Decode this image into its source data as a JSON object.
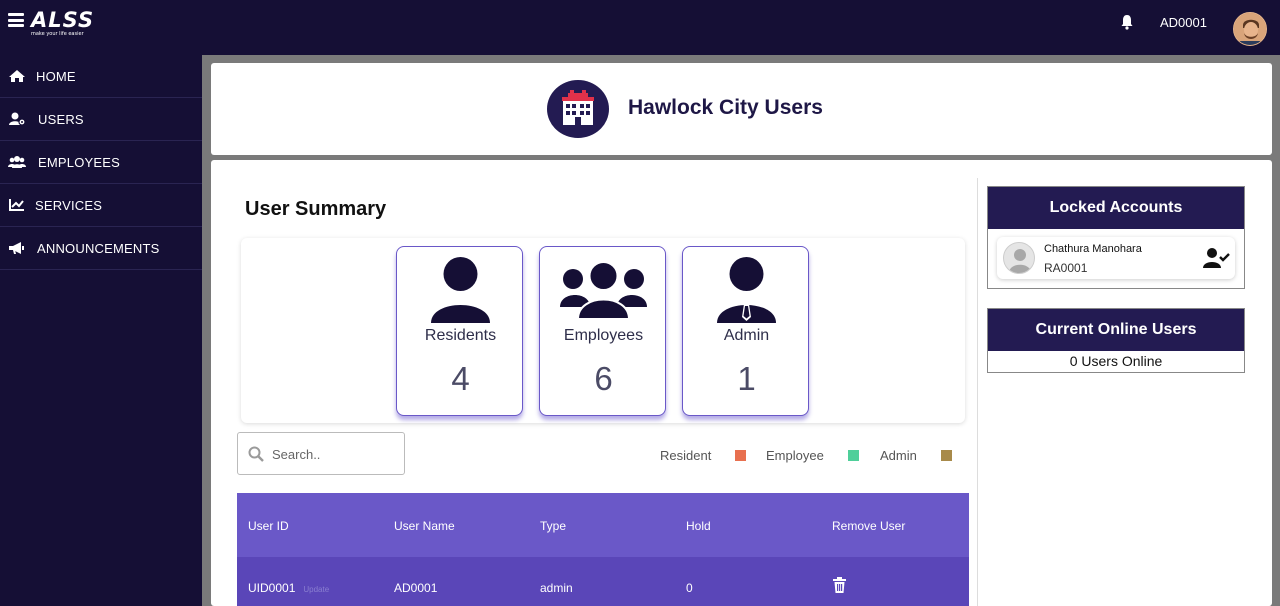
{
  "topbar": {
    "logo_text": "ALSS",
    "logo_tagline": "make your life easier",
    "user_code": "AD0001"
  },
  "sidebar": {
    "items": [
      {
        "label": "HOME",
        "icon": "home-icon"
      },
      {
        "label": "USERS",
        "icon": "users-gear-icon"
      },
      {
        "label": "EMPLOYEES",
        "icon": "group-icon"
      },
      {
        "label": "SERVICES",
        "icon": "chart-line-icon"
      },
      {
        "label": "ANNOUNCEMENTS",
        "icon": "megaphone-icon"
      }
    ]
  },
  "header": {
    "title": "Hawlock City Users",
    "icon": "building-icon"
  },
  "summary": {
    "title": "User Summary",
    "cards": [
      {
        "label": "Residents",
        "value": "4",
        "icon": "user-icon"
      },
      {
        "label": "Employees",
        "value": "6",
        "icon": "users-icon"
      },
      {
        "label": "Admin",
        "value": "1",
        "icon": "admin-tie-icon"
      }
    ]
  },
  "search": {
    "placeholder": "Search..",
    "value": ""
  },
  "legend": {
    "items": [
      {
        "label": "Resident",
        "color": "#e8704f"
      },
      {
        "label": "Employee",
        "color": "#4fcf9a"
      },
      {
        "label": "Admin",
        "color": "#a88a4a"
      }
    ]
  },
  "table": {
    "headers": [
      "User ID",
      "User Name",
      "Type",
      "Hold",
      "Remove User"
    ],
    "rows": [
      {
        "user_id": "UID0001",
        "update": "Update",
        "user_name": "AD0001",
        "type": "admin",
        "hold": "0"
      }
    ]
  },
  "locked_accounts": {
    "title": "Locked Accounts",
    "items": [
      {
        "name": "Chathura Manohara",
        "id": "RA0001"
      }
    ]
  },
  "online_users": {
    "title": "Current Online Users",
    "count_text": "0 Users Online"
  },
  "colors": {
    "nav_bg": "#150f35",
    "accent": "#6a58c8",
    "row_bg": "#5a46b8",
    "header_dark": "#231b52"
  }
}
